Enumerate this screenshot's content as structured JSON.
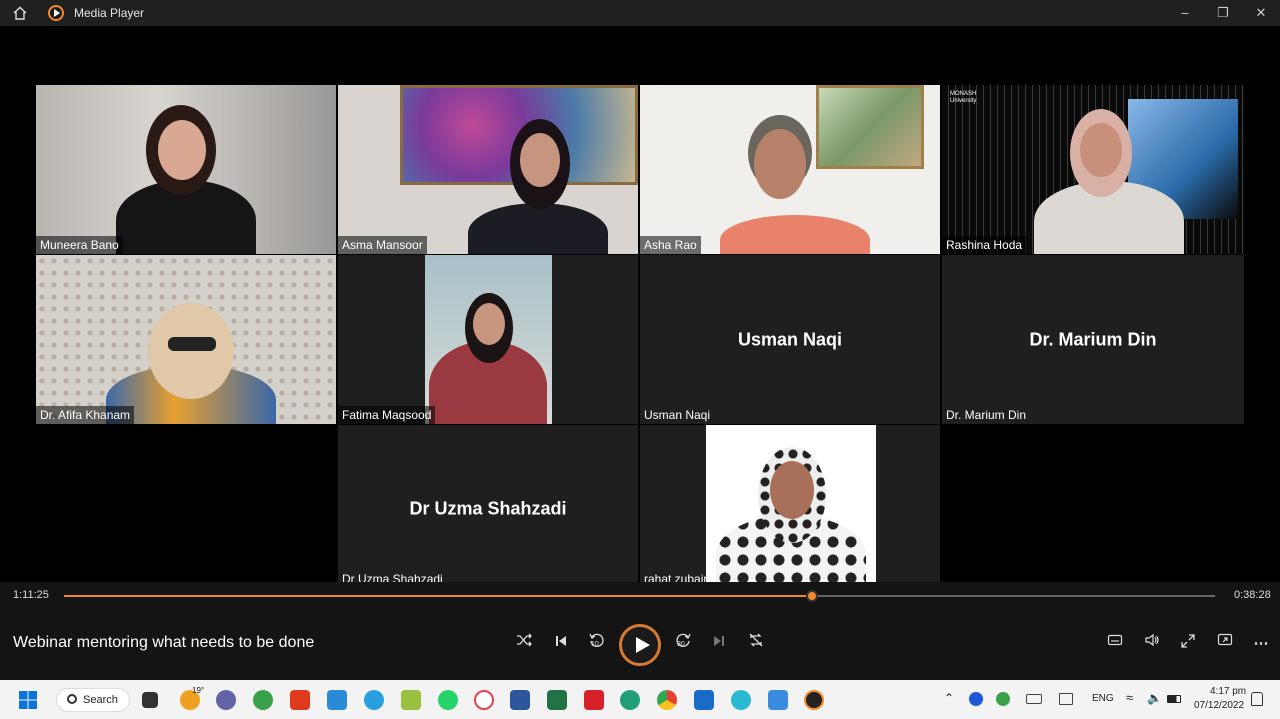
{
  "window": {
    "title": "Media Player"
  },
  "participants": [
    {
      "name": "Muneera Bano",
      "kind": "video"
    },
    {
      "name": "Asma Mansoor",
      "kind": "video"
    },
    {
      "name": "Asha Rao",
      "kind": "video"
    },
    {
      "name": "Rashina Hoda",
      "kind": "video"
    },
    {
      "name": "Dr. Afifa Khanam",
      "kind": "video"
    },
    {
      "name": "Fatima Maqsood",
      "kind": "video"
    },
    {
      "name": "Usman Naqi",
      "kind": "avatar",
      "center_label": "Usman Naqi"
    },
    {
      "name": "Dr. Marium Din",
      "kind": "avatar",
      "center_label": "Dr. Marium Din"
    },
    {
      "name": "Dr Uzma Shahzadi",
      "kind": "avatar",
      "center_label": "Dr Uzma Shahzadi"
    },
    {
      "name": "rahat zubair",
      "kind": "photo"
    }
  ],
  "rashina_tile": {
    "logo_text": "MONASH University"
  },
  "playback": {
    "elapsed": "1:11:25",
    "remaining": "0:38:28",
    "progress_fraction": 0.65,
    "media_title": "Webinar mentoring what needs to be done",
    "skip_back_label": "10",
    "skip_forward_label": "30"
  },
  "taskbar": {
    "search_label": "Search",
    "weather_temp": "19°",
    "language": "ENG",
    "time": "4:17 pm",
    "date": "07/12/2022"
  },
  "colors": {
    "accent": "#f08a2b",
    "tile_bg": "#1f1f1f",
    "chrome_bg": "#141414"
  }
}
